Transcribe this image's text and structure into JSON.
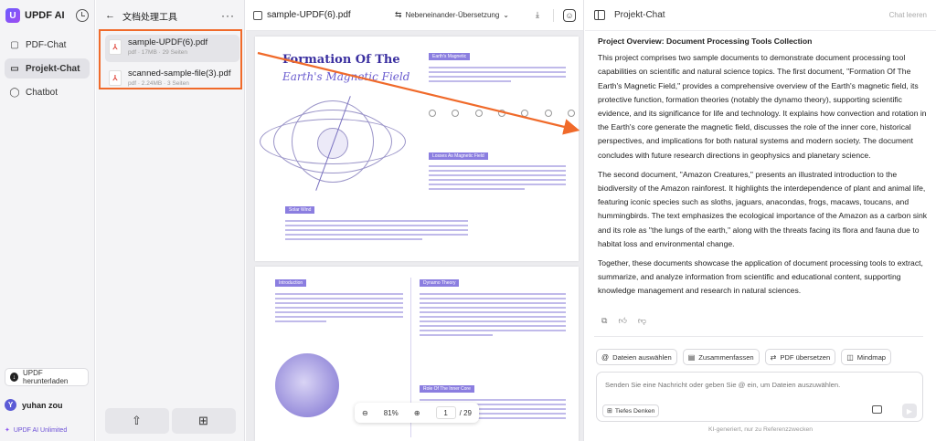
{
  "app": {
    "title": "UPDF AI"
  },
  "nav": {
    "items": [
      {
        "label": "PDF-Chat"
      },
      {
        "label": "Projekt-Chat",
        "active": true
      },
      {
        "label": "Chatbot"
      }
    ],
    "download_label": "UPDF herunterladen",
    "user": {
      "initial": "Y",
      "name": "yuhan zou"
    },
    "plan_label": "UPDF AI Unlimited"
  },
  "docs": {
    "title": "文档处理工具",
    "files": [
      {
        "name": "sample-UPDF(6).pdf",
        "meta": "pdf · 17MB · 29 Seiten",
        "selected": true
      },
      {
        "name": "scanned-sample-file(3).pdf",
        "meta": "pdf · 2.24MB · 3 Seiten"
      }
    ]
  },
  "viewer": {
    "filename": "sample-UPDF(6).pdf",
    "mode_label": "Nebeneinander-Übersetzung",
    "zoom": "81%",
    "page_current": "1",
    "page_total": "/ 29",
    "page1": {
      "title_line1": "Formation Of The",
      "title_line2": "Earth's Magnetic Field",
      "tag1": "Earth's Magnetic",
      "tag2": "Losses As Magnetic Field",
      "tag3": "Solar Wind"
    },
    "page2": {
      "tag1": "Introduction",
      "tag2": "Dynamo Theory",
      "tag3": "Role Of The Inner Core"
    }
  },
  "chat": {
    "header_title": "Projekt-Chat",
    "clear_label": "Chat leeren",
    "heading": "Project Overview: Document Processing Tools Collection",
    "paragraphs": [
      "This project comprises two sample documents to demonstrate document processing tool capabilities on scientific and natural science topics. The first document, \"Formation Of The Earth's Magnetic Field,\" provides a comprehensive overview of the Earth's magnetic field, its protective function, formation theories (notably the dynamo theory), supporting scientific evidence, and its significance for life and technology. It explains how convection and rotation in the Earth's core generate the magnetic field, discusses the role of the inner core, historical perspectives, and implications for both natural systems and modern society. The document concludes with future research directions in geophysics and planetary science.",
      "The second document, \"Amazon Creatures,\" presents an illustrated introduction to the biodiversity of the Amazon rainforest. It highlights the interdependence of plant and animal life, featuring iconic species such as sloths, jaguars, anacondas, frogs, macaws, toucans, and hummingbirds. The text emphasizes the ecological importance of the Amazon as a carbon sink and its role as \"the lungs of the earth,\" along with the threats facing its flora and fauna due to habitat loss and environmental change.",
      "Together, these documents showcase the application of document processing tools to extract, summarize, and analyze information from scientific and educational content, supporting knowledge management and research in natural sciences."
    ],
    "chips": [
      {
        "icon": "@",
        "label": "Dateien auswählen"
      },
      {
        "icon": "▤",
        "label": "Zusammenfassen"
      },
      {
        "icon": "⇄",
        "label": "PDF übersetzen"
      },
      {
        "icon": "◫",
        "label": "Mindmap"
      }
    ],
    "input_placeholder": "Senden Sie eine Nachricht oder geben Sie @ ein, um Dateien auszuwählen.",
    "deep_think_label": "Tiefes Denken",
    "footer_note": "KI-generiert, nur zu Referenzzwecken"
  },
  "colors": {
    "highlight": "#f06a2a",
    "accent": "#6b5cff"
  }
}
